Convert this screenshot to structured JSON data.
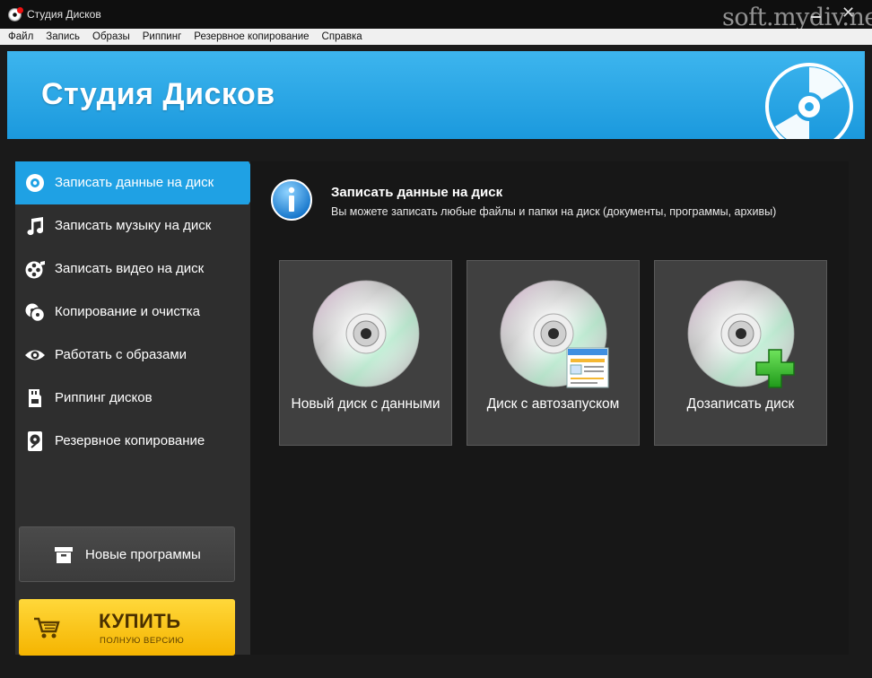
{
  "window": {
    "title": "Студия Дисков",
    "watermark": "soft.mydiv.net"
  },
  "menu": [
    "Файл",
    "Запись",
    "Образы",
    "Риппинг",
    "Резервное копирование",
    "Справка"
  ],
  "banner": {
    "title": "Студия Дисков"
  },
  "sidebar": {
    "items": [
      {
        "label": "Записать данные на диск",
        "icon": "disc-icon",
        "active": true
      },
      {
        "label": "Записать музыку на диск",
        "icon": "music-note-icon",
        "active": false
      },
      {
        "label": "Записать видео на диск",
        "icon": "film-reel-icon",
        "active": false
      },
      {
        "label": "Копирование и очистка",
        "icon": "copy-discs-icon",
        "active": false
      },
      {
        "label": "Работать с образами",
        "icon": "eye-icon",
        "active": false
      },
      {
        "label": "Риппинг дисков",
        "icon": "sd-card-icon",
        "active": false
      },
      {
        "label": "Резервное копирование",
        "icon": "hard-drive-icon",
        "active": false
      }
    ],
    "new_programs_label": "Новые программы",
    "buy": {
      "main": "КУПИТЬ",
      "sub": "ПОЛНУЮ ВЕРСИЮ"
    }
  },
  "main": {
    "title": "Записать данные на диск",
    "subtitle": "Вы можете записать любые файлы и папки на диск (документы, программы, архивы)",
    "cards": [
      {
        "label": "Новый диск с данными",
        "badge": null
      },
      {
        "label": "Диск с автозапуском",
        "badge": "window-icon"
      },
      {
        "label": "Дозаписать диск",
        "badge": "plus-icon"
      }
    ]
  },
  "colors": {
    "accent": "#1fa1e4",
    "banner": "#2aa8e8",
    "buy": "#f7c20f",
    "plus": "#2fb52a"
  }
}
